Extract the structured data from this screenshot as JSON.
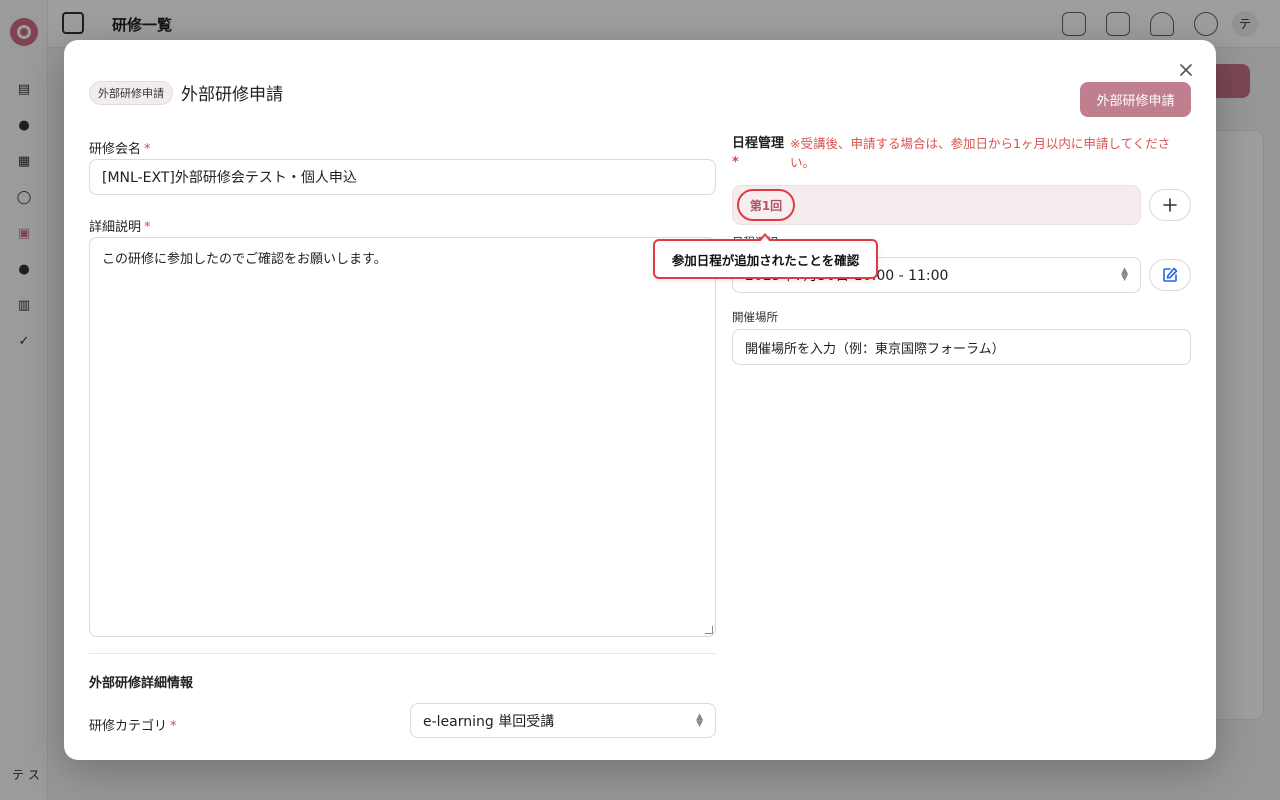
{
  "background": {
    "page_title": "研修一覧",
    "user_initials": "テ",
    "footer_user": "テ ス"
  },
  "modal": {
    "badge": "外部研修申請",
    "title": "外部研修申請",
    "submit_label": "外部研修申請",
    "training_name": {
      "label": "研修会名",
      "required_mark": "*",
      "value": "[MNL-EXT]外部研修会テスト・個人申込"
    },
    "description": {
      "label": "詳細説明",
      "required_mark": "*",
      "value": "この研修に参加したのでご確認をお願いします。"
    },
    "detail_section_title": "外部研修詳細情報",
    "category": {
      "label": "研修カテゴリ",
      "required_mark": "*",
      "value": "e-learning 単回受講"
    },
    "schedule": {
      "label": "日程管理",
      "required_mark": "*",
      "note": "※受講後、申請する場合は、参加日から1ヶ月以内に申請してください。",
      "round_label": "第1回",
      "datetime_label": "日程選択",
      "datetime_value": "2025年7月30日 10:00 - 11:00",
      "location_label": "開催場所",
      "location_placeholder": "開催場所を入力（例：東京国際フォーラム）"
    },
    "callout_text": "参加日程が追加されたことを確認"
  },
  "colors": {
    "accent": "#bf7f8f",
    "required": "#d1495b",
    "highlight": "#e03b43"
  }
}
